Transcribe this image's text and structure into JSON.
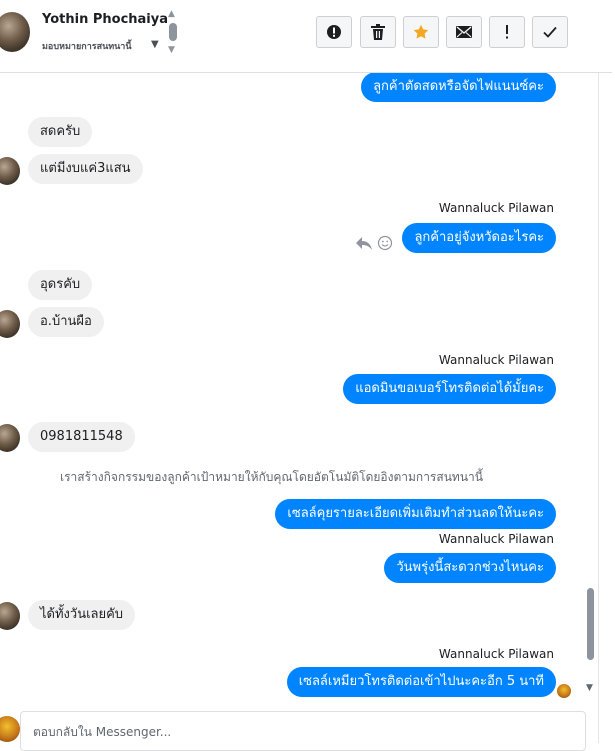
{
  "header": {
    "contact_name": "Yothin Phochaiya",
    "assign_label": "มอบหมายการสนทนานี้",
    "buttons": [
      {
        "name": "report-button",
        "icon": "exclamation-circle-icon"
      },
      {
        "name": "delete-button",
        "icon": "trash-icon"
      },
      {
        "name": "star-button",
        "icon": "star-icon"
      },
      {
        "name": "mark-unread-button",
        "icon": "envelope-icon"
      },
      {
        "name": "spam-button",
        "icon": "exclamation-icon"
      },
      {
        "name": "done-button",
        "icon": "check-icon"
      }
    ],
    "star_color": "#f5a623"
  },
  "messages": {
    "m0": "ลูกค้าตัดสดหรือจัดไฟแนนซ์คะ",
    "m1": "สดครับ",
    "m2": "แต่มีงบแค่3แสน",
    "s1": "Wannaluck Pilawan",
    "m3": "ลูกค้าอยู่จังหวัดอะไรคะ",
    "m4": "อุดรคับ",
    "m5": "อ.บ้านผือ",
    "s2": "Wannaluck Pilawan",
    "m6": "แอดมินขอเบอร์โทรติดต่อได้มั้ยคะ",
    "m7": "0981811548",
    "system_note": "เราสร้างกิจกรรมของลูกค้าเป้าหมายให้กับคุณโดยอัตโนมัติโดยอิงตามการสนทนานี้",
    "m8": "เซลล์คุยรายละเอียดเพิ่มเติมทำส่วนลดให้นะคะ",
    "s3": "Wannaluck Pilawan",
    "m9": "วันพรุ่งนี้สะดวกช่วงไหนคะ",
    "m10": "ได้ทั้งวันเลยคับ",
    "s4": "Wannaluck Pilawan",
    "m11": "เซลล์เหมียวโทรติดต่อเข้าไปนะคะอีก  5 นาที"
  },
  "composer": {
    "placeholder": "ตอบกลับใน Messenger..."
  },
  "colors": {
    "outgoing_bubble": "#0084ff",
    "incoming_bubble": "#f1f0f0"
  }
}
